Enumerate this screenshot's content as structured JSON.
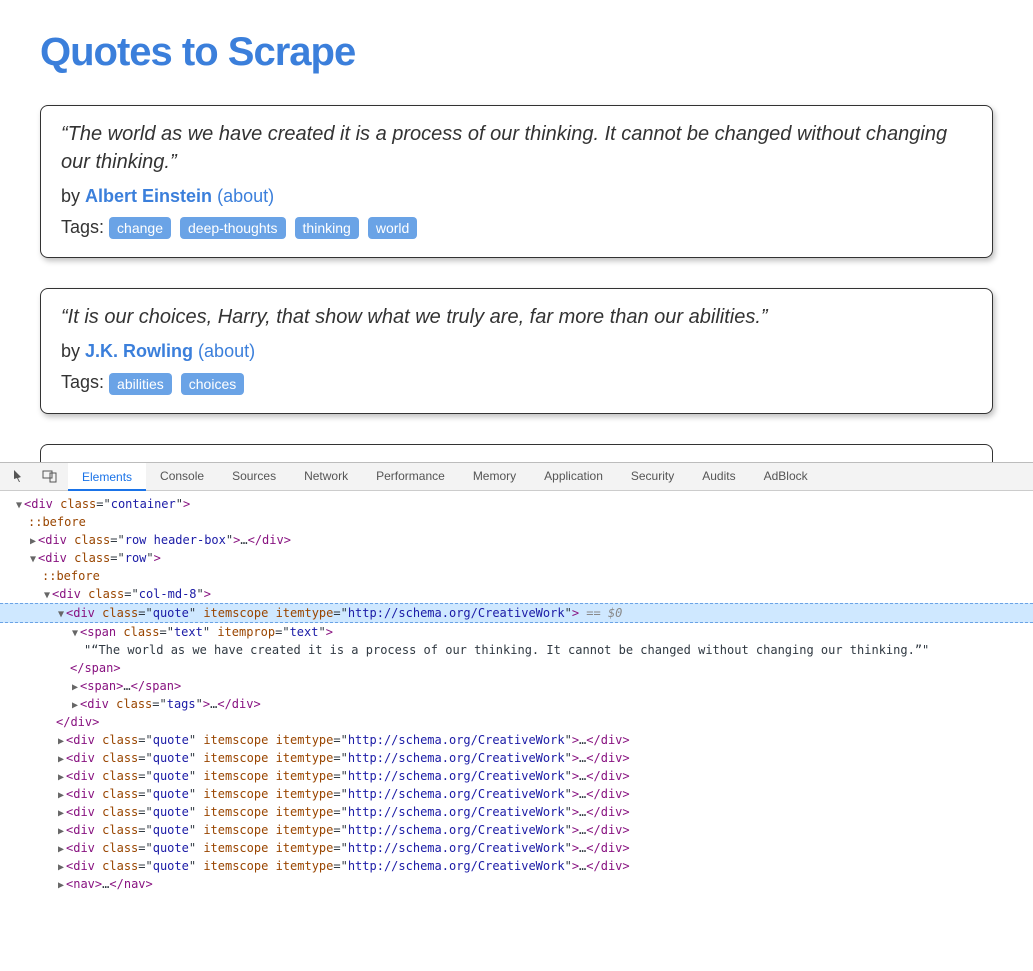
{
  "header": {
    "title": "Quotes to Scrape"
  },
  "by_label": "by",
  "about_label": "(about)",
  "tags_label": "Tags:",
  "quotes": [
    {
      "text": "“The world as we have created it is a process of our thinking. It cannot be changed without changing our thinking.”",
      "author": "Albert Einstein",
      "tags": [
        "change",
        "deep-thoughts",
        "thinking",
        "world"
      ]
    },
    {
      "text": "“It is our choices, Harry, that show what we truly are, far more than our abilities.”",
      "author": "J.K. Rowling",
      "tags": [
        "abilities",
        "choices"
      ]
    }
  ],
  "devtools": {
    "tabs": [
      "Elements",
      "Console",
      "Sources",
      "Network",
      "Performance",
      "Memory",
      "Application",
      "Security",
      "Audits",
      "AdBlock"
    ],
    "active_tab": "Elements",
    "tree": {
      "container_tag": "div",
      "container_class": "container",
      "pseudo_before": "::before",
      "header_row_tag": "div",
      "header_row_class": "row header-box",
      "row_tag": "div",
      "row_class": "row",
      "col_tag": "div",
      "col_class": "col-md-8",
      "quote_tag": "div",
      "quote_class": "quote",
      "itemscope_attr": "itemscope",
      "itemtype_attr": "itemtype",
      "itemtype_val": "http://schema.org/CreativeWork",
      "eq0": "== $0",
      "span_tag": "span",
      "text_class": "text",
      "itemprop_attr": "itemprop",
      "itemprop_val": "text",
      "quote_text_node": "\"“The world as we have created it is a process of our thinking. It cannot be changed without changing our thinking.”\"",
      "tags_div_class": "tags",
      "nav_tag": "nav",
      "collapsed_count": 8
    }
  }
}
